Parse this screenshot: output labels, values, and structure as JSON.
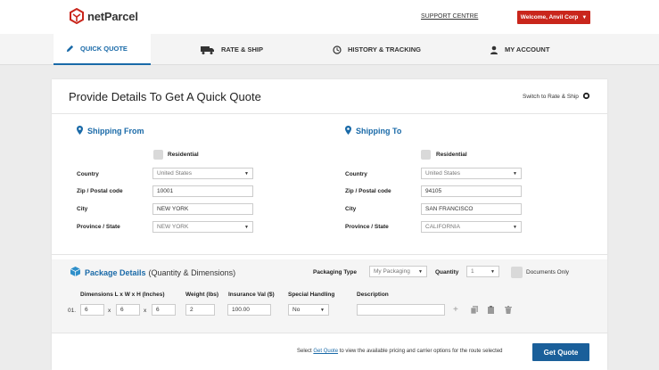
{
  "header": {
    "logo_text": "netParcel",
    "support_link": "SUPPORT CENTRE",
    "welcome": "Welcome, Anvil Corp"
  },
  "nav": {
    "items": [
      {
        "label": "QUICK QUOTE",
        "icon": "pencil-icon"
      },
      {
        "label": "RATE & SHIP",
        "icon": "truck-icon"
      },
      {
        "label": "HISTORY & TRACKING",
        "icon": "clock-icon"
      },
      {
        "label": "MY ACCOUNT",
        "icon": "user-icon"
      }
    ]
  },
  "page": {
    "title": "Provide Details To Get A Quick Quote",
    "switch_link": "Switch to Rate & Ship"
  },
  "shipping_from": {
    "heading": "Shipping From",
    "residential_label": "Residential",
    "country_label": "Country",
    "country_value": "United States",
    "zip_label": "Zip / Postal code",
    "zip_value": "10001",
    "city_label": "City",
    "city_value": "NEW YORK",
    "province_label": "Province / State",
    "province_value": "NEW YORK"
  },
  "shipping_to": {
    "heading": "Shipping To",
    "residential_label": "Residential",
    "country_label": "Country",
    "country_value": "United States",
    "zip_label": "Zip / Postal code",
    "zip_value": "94105",
    "city_label": "City",
    "city_value": "SAN FRANCISCO",
    "province_label": "Province / State",
    "province_value": "CALIFORNIA"
  },
  "package": {
    "heading": "Package Details",
    "subheading": "(Quantity & Dimensions)",
    "packaging_type_label": "Packaging Type",
    "packaging_type_value": "My Packaging",
    "quantity_label": "Quantity",
    "quantity_value": "1",
    "documents_only_label": "Documents Only",
    "col_dimensions": "Dimensions L x W x H (Inches)",
    "col_weight": "Weight (lbs)",
    "col_insurance": "Insurance Val ($)",
    "col_special": "Special Handling",
    "col_description": "Description",
    "row": {
      "index": "01.",
      "length": "6",
      "width": "6",
      "height": "6",
      "x1": "x",
      "x2": "x",
      "weight": "2",
      "insurance": "100.00",
      "special": "No",
      "description": ""
    }
  },
  "footer": {
    "note_before": "Select",
    "note_link": "Get Quote",
    "note_after": "to view the available pricing and carrier options for the route selected",
    "button": "Get Quote"
  },
  "colors": {
    "accent": "#1a6aa8",
    "brand_red": "#c9261c",
    "button": "#1a5f9a"
  }
}
